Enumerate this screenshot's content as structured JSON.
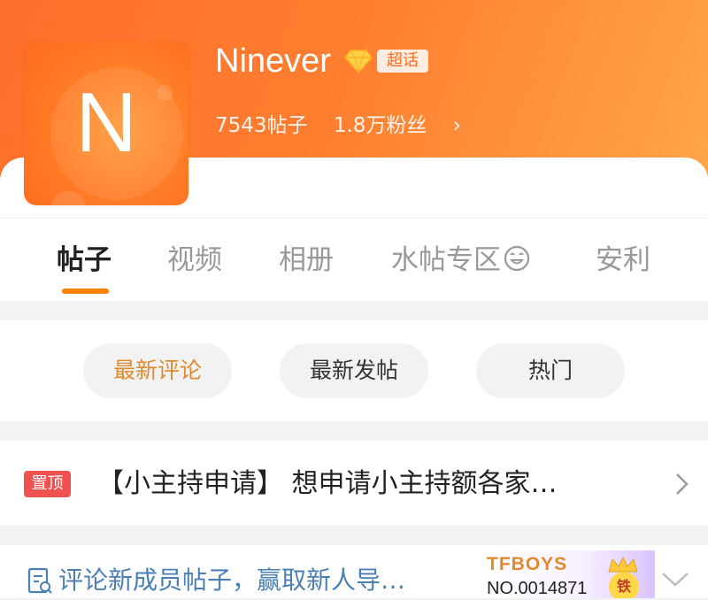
{
  "header": {
    "avatar_letter": "N",
    "title": "Ninever",
    "super_badge": "超话",
    "posts_count": "7543帖子",
    "fans_count": "1.8万粉丝",
    "chevron": "›",
    "accent_color": "#ff7a2a"
  },
  "tabs": [
    {
      "label": "帖子",
      "active": true
    },
    {
      "label": "视频",
      "active": false
    },
    {
      "label": "相册",
      "active": false
    },
    {
      "label": "水帖专区",
      "active": false
    },
    {
      "label": "安利",
      "active": false
    }
  ],
  "sort": [
    {
      "label": "最新评论",
      "active": true
    },
    {
      "label": "最新发帖",
      "active": false
    },
    {
      "label": "热门",
      "active": false
    }
  ],
  "pinned": {
    "badge": "置顶",
    "text": "【小主持申请】 想申请小主持额各家…"
  },
  "notice": {
    "text": "评论新成员帖子，赢取新人导…",
    "fan_badge_name": "TFBOYS",
    "fan_badge_no": "NO.0014871",
    "fan_badge_level": "铁"
  },
  "icons": [
    "diamond-icon",
    "chevron-right-icon",
    "laugh-cry-icon",
    "note-icon",
    "crown-icon",
    "chevron-down-icon"
  ]
}
